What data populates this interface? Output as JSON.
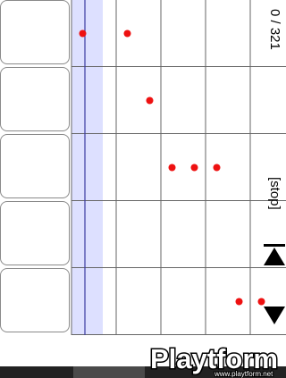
{
  "status": {
    "position_text": "0 / 321",
    "playback_text": "[stop]"
  },
  "grid": {
    "rows": 5,
    "columns": 5,
    "playhead_column": 0.3,
    "notes": [
      {
        "row": 0,
        "col": 0.25
      },
      {
        "row": 0,
        "col": 1.25
      },
      {
        "row": 1,
        "col": 1.75
      },
      {
        "row": 2,
        "col": 2.25
      },
      {
        "row": 2,
        "col": 2.75
      },
      {
        "row": 2,
        "col": 3.25
      },
      {
        "row": 4,
        "col": 3.75
      },
      {
        "row": 4,
        "col": 4.25
      }
    ]
  },
  "controls": {
    "up_icon": "scroll-top-icon",
    "down_icon": "scroll-down-icon"
  },
  "watermark": {
    "brand": "Playtform",
    "url": "www.playtform.net"
  },
  "colors": {
    "note": "#ee1111",
    "playhead": "#3a3aa0",
    "highlight": "#dde0ff",
    "grid": "#666666"
  }
}
